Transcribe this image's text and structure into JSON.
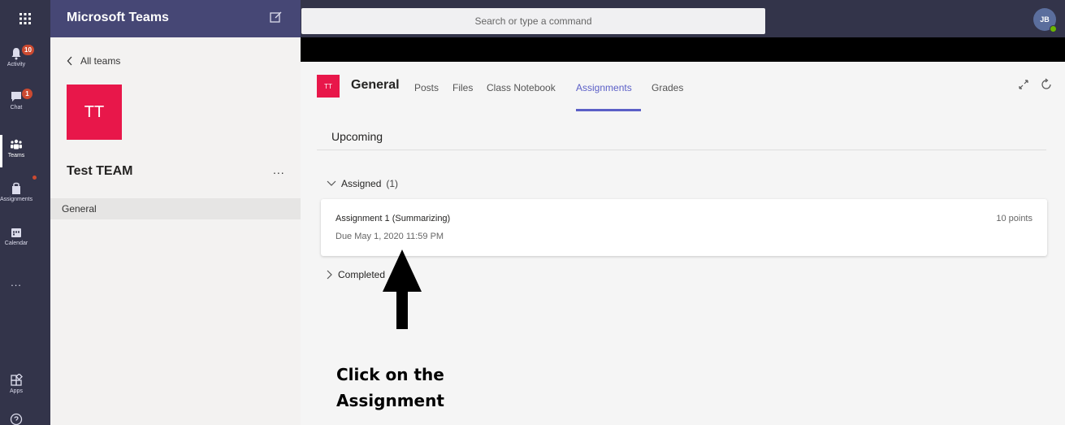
{
  "topbar": {
    "app_title": "Microsoft Teams",
    "search_placeholder": "Search or type a command",
    "avatar_initials": "JB"
  },
  "rail": {
    "items": [
      {
        "label": "Activity",
        "icon": "bell-icon",
        "badge": "10"
      },
      {
        "label": "Chat",
        "icon": "chat-icon",
        "badge": "1"
      },
      {
        "label": "Teams",
        "icon": "teams-icon"
      },
      {
        "label": "Assignments",
        "icon": "assignments-icon"
      },
      {
        "label": "Calendar",
        "icon": "calendar-icon"
      },
      {
        "label": "...",
        "icon": "more-icon"
      },
      {
        "label": "Apps",
        "icon": "apps-icon"
      }
    ]
  },
  "teams_panel": {
    "back_label": "All teams",
    "team_initials": "TT",
    "team_name": "Test TEAM",
    "more": "...",
    "channel": "General"
  },
  "main": {
    "channel_initials": "TT",
    "channel_title": "General",
    "tabs": [
      "Posts",
      "Files",
      "Class Notebook",
      "Assignments",
      "Grades"
    ],
    "active_tab": "Assignments",
    "section_title": "Upcoming",
    "assigned_label": "Assigned",
    "assigned_count": "(1)",
    "assignment": {
      "title": "Assignment 1 (Summarizing)",
      "due": "Due May 1, 2020 11:59 PM",
      "points": "10 points"
    },
    "completed_label": "Completed",
    "callout_line1": "Click on the",
    "callout_line2": "Assignment"
  },
  "colors": {
    "rail": "#33344a",
    "header": "#464775",
    "accent": "#5b5fc7",
    "team_tile": "#e8174a",
    "badge": "#cc4a31"
  }
}
